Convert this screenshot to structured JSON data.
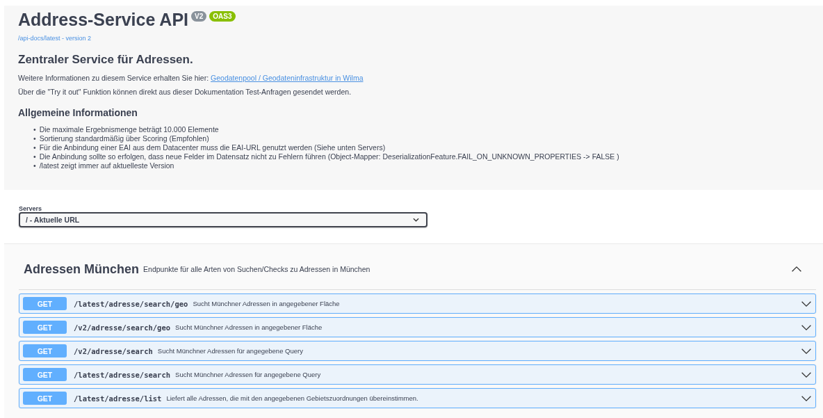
{
  "info": {
    "title": "Address-Service API",
    "badges": [
      {
        "label": "V2",
        "color": "#89929b"
      },
      {
        "label": "OAS3",
        "color": "#89bf04"
      }
    ],
    "url": "/api-docs/latest - version 2",
    "heading": "Zentraler Service für Adressen.",
    "intro": "Weitere Informationen zu diesem Service erhalten Sie hier:",
    "link": "Geodatenpool / Geodateninfrastruktur in Wilma",
    "note": "Über die \"Try it out\" Funktion können direkt aus dieser Dokumentation Test-Anfragen gesendet werden.",
    "subheading": "Allgemeine Informationen",
    "bullet_marker": "•",
    "bullets": [
      "Die maximale Ergebnismenge beträgt 10.000 Elemente",
      "Sortierung standardmäßig über Scoring (Empfohlen)",
      "Für die Anbindung einer EAI aus dem Datacenter muss die EAI-URL genutzt werden (Siehe unten Servers)",
      "Die Anbindung sollte so erfolgen, dass neue Felder im Datensatz nicht zu Fehlern führen (Object-Mapper: DeserializationFeature.FAIL_ON_UNKNOWN_PROPERTIES -> FALSE )",
      "/latest zeigt immer auf aktuelleste Version"
    ]
  },
  "servers": {
    "label": "Servers",
    "value": "/ - Aktuelle URL"
  },
  "tag": {
    "name": "Adressen München",
    "description": "Endpunkte für alle Arten von Suchen/Checks zu Adressen in München",
    "expanded": true,
    "operations": [
      {
        "method": "GET",
        "path": "/latest/adresse/search/geo",
        "summary": "Sucht Münchner Adressen in angegebener Fläche",
        "expanded": false
      },
      {
        "method": "GET",
        "path": "/v2/adresse/search/geo",
        "summary": "Sucht Münchner Adressen in angegebener Fläche",
        "expanded": false
      },
      {
        "method": "GET",
        "path": "/v2/adresse/search",
        "summary": "Sucht Münchner Adressen für angegebene Query",
        "expanded": false
      },
      {
        "method": "GET",
        "path": "/latest/adresse/search",
        "summary": "Sucht Münchner Adressen für angegebene Query",
        "expanded": false
      },
      {
        "method": "GET",
        "path": "/latest/adresse/list",
        "summary": "Liefert alle Adressen, die mit den angegebenen Gebietszuordnungen übereinstimmen.",
        "expanded": false
      }
    ]
  }
}
